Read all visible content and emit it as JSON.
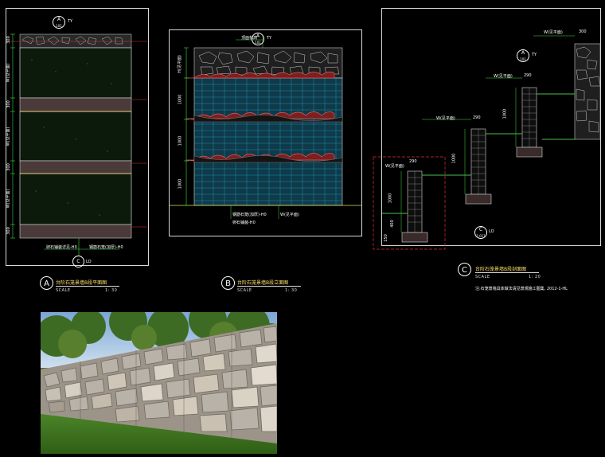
{
  "drawing_a": {
    "letter": "A",
    "title": "台阶石笼景墙B段平面图",
    "scale_label": "SCALE",
    "scale_value": "1: 30",
    "section_ref_letter": "A",
    "section_ref_code": "TY",
    "section_ref_num": "101",
    "callout_letter": "C",
    "callout_code": "LO",
    "dims": [
      "300",
      "W(见平面)",
      "300",
      "W(见平面)",
      "300",
      "W(见平面)",
      "300"
    ],
    "notes": [
      "卵石铺装详见-H0",
      "钢筋石笼(加厚)-H0"
    ]
  },
  "drawing_b": {
    "letter": "B",
    "title": "台阶石笼景墙B段立面图",
    "scale_label": "SCALE",
    "scale_value": "1: 30",
    "section_ref_letter": "A",
    "section_ref_code": "TY",
    "section_ref_num": "101",
    "top_label": "顶面标高",
    "dims": [
      "H(见平面)",
      "1000",
      "1000",
      "1000"
    ],
    "notes": [
      "钢筋石笼(加厚)-H0",
      "卵石铺装-H0",
      "W(见平面)"
    ]
  },
  "drawing_c": {
    "letter": "C",
    "title": "台阶石笼景墙B段剖面图",
    "scale_label": "SCALE",
    "scale_value": "1: 20",
    "section_ref_letter": "A",
    "section_ref_code": "TY",
    "section_ref_num": "101",
    "detail_letter": "C",
    "detail_code": "LO",
    "detail_num": "2.011",
    "widths": [
      "W(见平面)",
      "W(见平面)",
      "W(见平面)",
      "W(见平面)"
    ],
    "wall_width": "290",
    "wall_width_top": "300",
    "heights": [
      "1000",
      "1000",
      "1000"
    ],
    "bottom_dims": [
      "150",
      "400"
    ],
    "footnote": "注:石笼景墙具体做法请见景观施工图集, 2012-1-HL"
  },
  "colors": {
    "frame": "#d8d8d8",
    "gabion_green": "#4ac04a",
    "water_cyan": "#30b8e0",
    "grass_red": "#e05a5a",
    "dim_green": "#3fe03f",
    "title_yellow": "#ffe36a",
    "detail_red": "#e03030"
  }
}
